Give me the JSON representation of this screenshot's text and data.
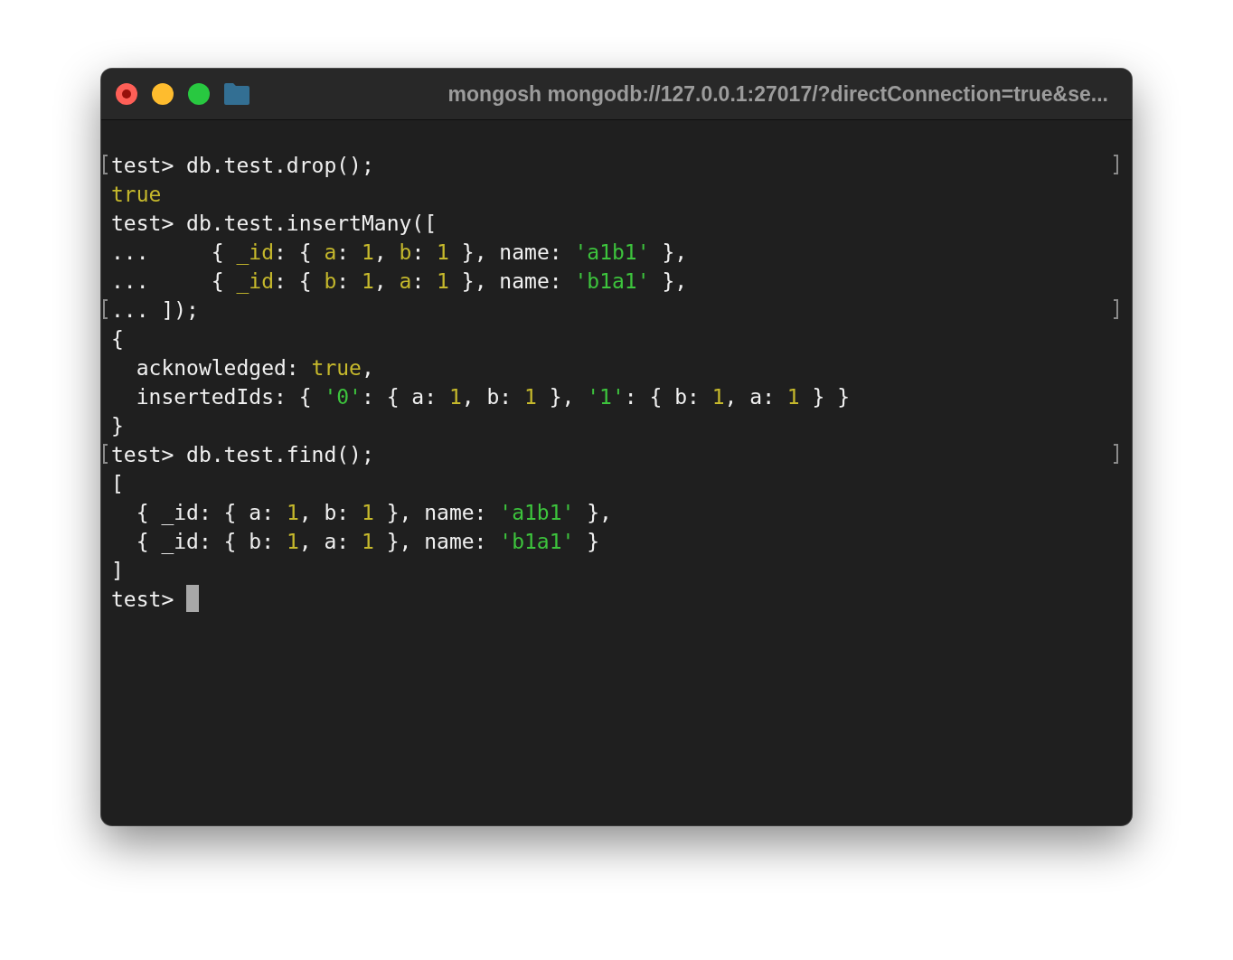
{
  "window": {
    "title": "mongosh mongodb://127.0.0.1:27017/?directConnection=true&se..."
  },
  "lines": [
    {
      "marked": true,
      "segments": [
        {
          "kind": "plain",
          "text": "test> db.test.drop();"
        }
      ]
    },
    {
      "marked": false,
      "segments": [
        {
          "kind": "keyword",
          "text": "true"
        }
      ]
    },
    {
      "marked": false,
      "segments": [
        {
          "kind": "plain",
          "text": "test> db.test.insertMany(["
        }
      ]
    },
    {
      "marked": false,
      "segments": [
        {
          "kind": "plain",
          "text": "...     { "
        },
        {
          "kind": "key",
          "text": "_id"
        },
        {
          "kind": "plain",
          "text": ": { "
        },
        {
          "kind": "key",
          "text": "a"
        },
        {
          "kind": "plain",
          "text": ": "
        },
        {
          "kind": "number",
          "text": "1"
        },
        {
          "kind": "plain",
          "text": ", "
        },
        {
          "kind": "key",
          "text": "b"
        },
        {
          "kind": "plain",
          "text": ": "
        },
        {
          "kind": "number",
          "text": "1"
        },
        {
          "kind": "plain",
          "text": " }, name: "
        },
        {
          "kind": "string",
          "text": "'a1b1'"
        },
        {
          "kind": "plain",
          "text": " },"
        }
      ]
    },
    {
      "marked": false,
      "segments": [
        {
          "kind": "plain",
          "text": "...     { "
        },
        {
          "kind": "key",
          "text": "_id"
        },
        {
          "kind": "plain",
          "text": ": { "
        },
        {
          "kind": "key",
          "text": "b"
        },
        {
          "kind": "plain",
          "text": ": "
        },
        {
          "kind": "number",
          "text": "1"
        },
        {
          "kind": "plain",
          "text": ", "
        },
        {
          "kind": "key",
          "text": "a"
        },
        {
          "kind": "plain",
          "text": ": "
        },
        {
          "kind": "number",
          "text": "1"
        },
        {
          "kind": "plain",
          "text": " }, name: "
        },
        {
          "kind": "string",
          "text": "'b1a1'"
        },
        {
          "kind": "plain",
          "text": " },"
        }
      ]
    },
    {
      "marked": true,
      "segments": [
        {
          "kind": "plain",
          "text": "... ]);"
        }
      ]
    },
    {
      "marked": false,
      "segments": [
        {
          "kind": "plain",
          "text": "{"
        }
      ]
    },
    {
      "marked": false,
      "segments": [
        {
          "kind": "plain",
          "text": "  acknowledged: "
        },
        {
          "kind": "keyword",
          "text": "true"
        },
        {
          "kind": "plain",
          "text": ","
        }
      ]
    },
    {
      "marked": false,
      "segments": [
        {
          "kind": "plain",
          "text": "  insertedIds: { "
        },
        {
          "kind": "string",
          "text": "'0'"
        },
        {
          "kind": "plain",
          "text": ": { a: "
        },
        {
          "kind": "number",
          "text": "1"
        },
        {
          "kind": "plain",
          "text": ", b: "
        },
        {
          "kind": "number",
          "text": "1"
        },
        {
          "kind": "plain",
          "text": " }, "
        },
        {
          "kind": "string",
          "text": "'1'"
        },
        {
          "kind": "plain",
          "text": ": { b: "
        },
        {
          "kind": "number",
          "text": "1"
        },
        {
          "kind": "plain",
          "text": ", a: "
        },
        {
          "kind": "number",
          "text": "1"
        },
        {
          "kind": "plain",
          "text": " } }"
        }
      ]
    },
    {
      "marked": false,
      "segments": [
        {
          "kind": "plain",
          "text": "}"
        }
      ]
    },
    {
      "marked": true,
      "segments": [
        {
          "kind": "plain",
          "text": "test> db.test.find();"
        }
      ]
    },
    {
      "marked": false,
      "segments": [
        {
          "kind": "plain",
          "text": "["
        }
      ]
    },
    {
      "marked": false,
      "segments": [
        {
          "kind": "plain",
          "text": "  { _id: { a: "
        },
        {
          "kind": "number",
          "text": "1"
        },
        {
          "kind": "plain",
          "text": ", b: "
        },
        {
          "kind": "number",
          "text": "1"
        },
        {
          "kind": "plain",
          "text": " }, name: "
        },
        {
          "kind": "string",
          "text": "'a1b1'"
        },
        {
          "kind": "plain",
          "text": " },"
        }
      ]
    },
    {
      "marked": false,
      "segments": [
        {
          "kind": "plain",
          "text": "  { _id: { b: "
        },
        {
          "kind": "number",
          "text": "1"
        },
        {
          "kind": "plain",
          "text": ", a: "
        },
        {
          "kind": "number",
          "text": "1"
        },
        {
          "kind": "plain",
          "text": " }, name: "
        },
        {
          "kind": "string",
          "text": "'b1a1'"
        },
        {
          "kind": "plain",
          "text": " }"
        }
      ]
    },
    {
      "marked": false,
      "segments": [
        {
          "kind": "plain",
          "text": "]"
        }
      ]
    }
  ],
  "prompt": {
    "text": "test> ",
    "cursor": true
  }
}
